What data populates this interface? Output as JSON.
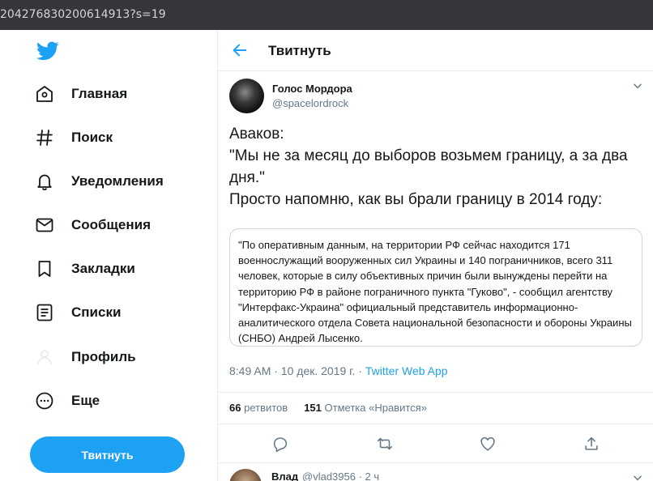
{
  "browser": {
    "url_fragment": "204276830200614913?s=19"
  },
  "sidebar": {
    "items": [
      {
        "label": "Главная"
      },
      {
        "label": "Поиск"
      },
      {
        "label": "Уведомления"
      },
      {
        "label": "Сообщения"
      },
      {
        "label": "Закладки"
      },
      {
        "label": "Списки"
      },
      {
        "label": "Профиль"
      },
      {
        "label": "Еще"
      }
    ],
    "tweet_button": "Твитнуть"
  },
  "header": {
    "title": "Твитнуть"
  },
  "tweet": {
    "author_name": "Голос Мордора",
    "author_handle": "@spacelordrock",
    "text_lines": [
      "Аваков:",
      "\"Мы не за месяц до выборов возьмем границу, а за два дня.\"",
      "Просто напомню, как вы брали границу в 2014 году:"
    ],
    "quote": "\"По оперативным данным, на территории РФ сейчас находится 171 военнослужащий вооруженных сил Украины и 140 пограничников, всего 311 человек, которые в силу объективных причин были вынуждены перейти на территорию РФ в районе пограничного пункта \"Гуково\", - сообщил агентству \"Интерфакс-Украина\" официальный представитель информационно-аналитического отдела Совета национальной безопасности и обороны Украины (СНБО) Андрей Лысенко.",
    "timestamp": "8:49 AM · 10 дек. 2019 г. · ",
    "via": "Twitter Web App",
    "retweets_count": "66",
    "retweets_label": "ретвитов",
    "likes_count": "151",
    "likes_label": "Отметка «Нравится»"
  },
  "reply": {
    "author_name": "Влад",
    "author_handle_time": "@vlad3956 · 2 ч"
  },
  "colors": {
    "accent": "#1da1f2",
    "text": "#14171a",
    "muted": "#657786",
    "border": "#e6ecf0"
  },
  "icons": [
    "twitter-logo-icon",
    "home-icon",
    "hashtag-icon",
    "bell-icon",
    "envelope-icon",
    "bookmark-icon",
    "list-icon",
    "profile-icon",
    "more-icon",
    "back-arrow-icon",
    "chevron-down-icon",
    "reply-icon",
    "retweet-icon",
    "like-icon",
    "share-icon"
  ]
}
